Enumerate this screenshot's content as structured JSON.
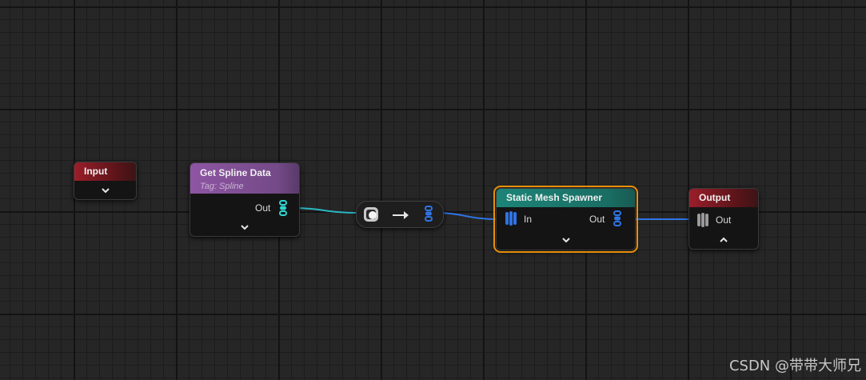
{
  "nodes": {
    "input": {
      "title": "Input",
      "header_color": "#9a1e2a"
    },
    "get_spline": {
      "title": "Get Spline Data",
      "subtitle": "Tag: Spline",
      "out_label": "Out",
      "header_color": "#8e55a3"
    },
    "static_mesh": {
      "title": "Static Mesh Spawner",
      "in_label": "In",
      "out_label": "Out",
      "header_color": "#1d8478",
      "selected": true,
      "selection_color": "#e8900a"
    },
    "output": {
      "title": "Output",
      "out_label": "Out",
      "header_color": "#9a1e2a"
    }
  },
  "icons": [
    "chevron-down-icon",
    "chevron-up-icon",
    "pin-stack-icon",
    "converter-icon",
    "arrow-right-icon"
  ],
  "wire_colors": {
    "spline": "#2bb7c4",
    "points": "#2f74e6"
  },
  "watermark": "CSDN @带带大师兄"
}
